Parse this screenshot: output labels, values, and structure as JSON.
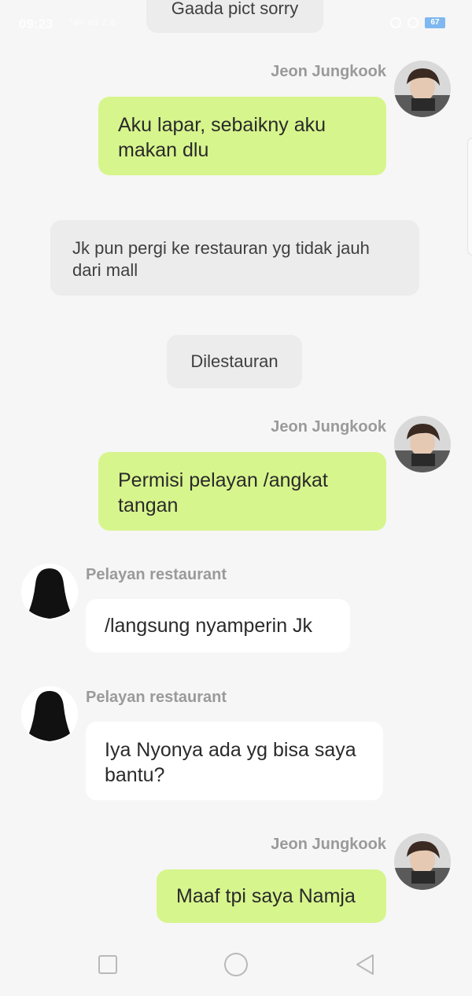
{
  "status_bar": {
    "time": "09:23",
    "signal_text": "°all all 2.6",
    "battery": "67"
  },
  "messages": [
    {
      "kind": "narration",
      "text": "Gaada pict sorry"
    },
    {
      "kind": "sent",
      "sender": "Jeon Jungkook",
      "text": "Aku lapar, sebaikny aku makan dlu"
    },
    {
      "kind": "narration",
      "text": "Jk pun pergi ke restauran yg tidak jauh dari mall"
    },
    {
      "kind": "narration",
      "text": "Dilestauran"
    },
    {
      "kind": "sent",
      "sender": "Jeon Jungkook",
      "text": "Permisi pelayan /angkat tangan"
    },
    {
      "kind": "received",
      "sender": "Pelayan restaurant",
      "text": "/langsung nyamperin Jk"
    },
    {
      "kind": "received",
      "sender": "Pelayan restaurant",
      "text": "Iya Nyonya ada yg bisa saya bantu?"
    },
    {
      "kind": "sent",
      "sender": "Jeon Jungkook",
      "text": "Maaf tpi saya Namja"
    }
  ],
  "colors": {
    "sent_bubble": "#d7f58d",
    "received_bubble": "#ffffff",
    "narration_bubble": "#ececec",
    "background": "#f6f6f6"
  },
  "icons": {
    "jungkook_avatar": "person-photo-avatar",
    "pelayan_avatar": "silhouette-avatar",
    "nav_recents": "square-icon",
    "nav_home": "circle-icon",
    "nav_back": "triangle-back-icon"
  }
}
